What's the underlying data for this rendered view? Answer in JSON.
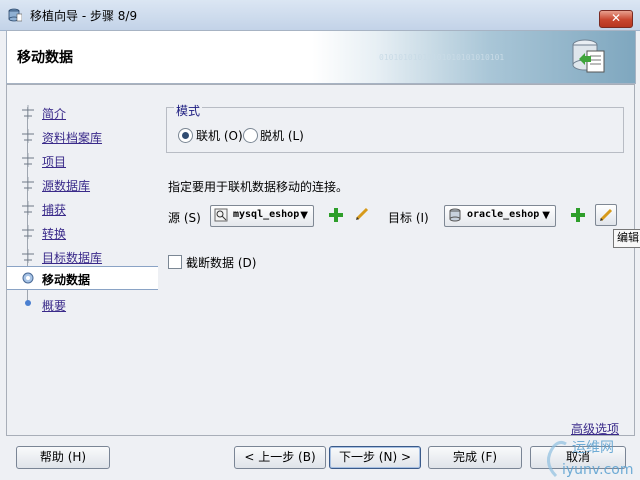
{
  "window": {
    "title": "移植向导 - 步骤 8/9",
    "close_label": "✕"
  },
  "header": {
    "page_title": "移动数据",
    "banner_bits": "01010101010101010101010101"
  },
  "steps": [
    {
      "label": "简介"
    },
    {
      "label": "资料档案库"
    },
    {
      "label": "项目"
    },
    {
      "label": "源数据库"
    },
    {
      "label": "捕获 "
    },
    {
      "label": "转换"
    },
    {
      "label": "目标数据库"
    },
    {
      "label": "移动数据"
    },
    {
      "label": "概要"
    }
  ],
  "mode": {
    "legend": "模式",
    "online_label": "联机 (O)",
    "offline_label": "脱机 (L)",
    "selected": "online"
  },
  "instruction": "指定要用于联机数据移动的连接。",
  "source": {
    "label": "源 (S)",
    "value": "mysql_eshop"
  },
  "target": {
    "label": "目标 (I)",
    "value": "oracle_eshop"
  },
  "truncate": {
    "label": "截断数据 (D)",
    "checked": false
  },
  "advanced_link": "高级选项",
  "tooltip": "编辑",
  "buttons": {
    "help": "帮助 (H)",
    "back": "< 上一步 (B)",
    "next": "下一步 (N) >",
    "finish": "完成 (F)",
    "cancel": "取消"
  },
  "watermark": {
    "text1": "运维网",
    "text2": "iyunv.com"
  },
  "colors": {
    "link": "#3a2a8a",
    "title_bg": "#c3d3e8",
    "close": "#c8452e",
    "legend": "#1c1c80"
  }
}
